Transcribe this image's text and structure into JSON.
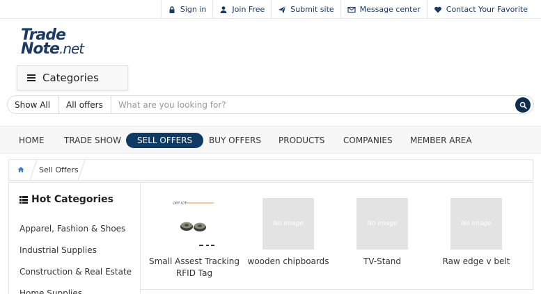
{
  "topbar": {
    "links": [
      {
        "label": "Sign in",
        "icon": "lock-icon"
      },
      {
        "label": "Join Free",
        "icon": "user-icon"
      },
      {
        "label": "Submit site",
        "icon": "paper-plane-icon"
      },
      {
        "label": "Message center",
        "icon": "envelope-icon"
      },
      {
        "label": "Contact Your Favorite",
        "icon": "heart-icon"
      }
    ]
  },
  "logo": {
    "line1": "Trade",
    "line2": "Note",
    "suffix": ".net"
  },
  "categories_button": {
    "label": "Categories"
  },
  "search": {
    "scope": "Show All",
    "type": "All offers",
    "placeholder": "What are you looking for?"
  },
  "nav": {
    "items": [
      "HOME",
      "TRADE SHOW",
      "SELL OFFERS",
      "BUY OFFERS",
      "PRODUCTS",
      "COMPANIES",
      "MEMBER AREA"
    ],
    "active": "SELL OFFERS"
  },
  "breadcrumb": {
    "current": "Sell Offers"
  },
  "sidebar": {
    "title": "Hot Categories",
    "categories": [
      "Apparel, Fashion & Shoes",
      "Industrial Supplies",
      "Construction & Real Estate",
      "Home Supplies"
    ]
  },
  "products": [
    {
      "name": "Small Assest Tracking RFID Tag",
      "image": "product-photo",
      "image_text": ""
    },
    {
      "name": "wooden chipboards",
      "image": "placeholder",
      "image_text": "No Image"
    },
    {
      "name": "TV-Stand",
      "image": "placeholder",
      "image_text": "No Image"
    },
    {
      "name": "Raw edge v belt",
      "image": "placeholder",
      "image_text": "No Image"
    }
  ],
  "colors": {
    "brand": "#0e3a63",
    "link": "#1a3a63",
    "placeholder_bg": "#e3e3e3"
  }
}
